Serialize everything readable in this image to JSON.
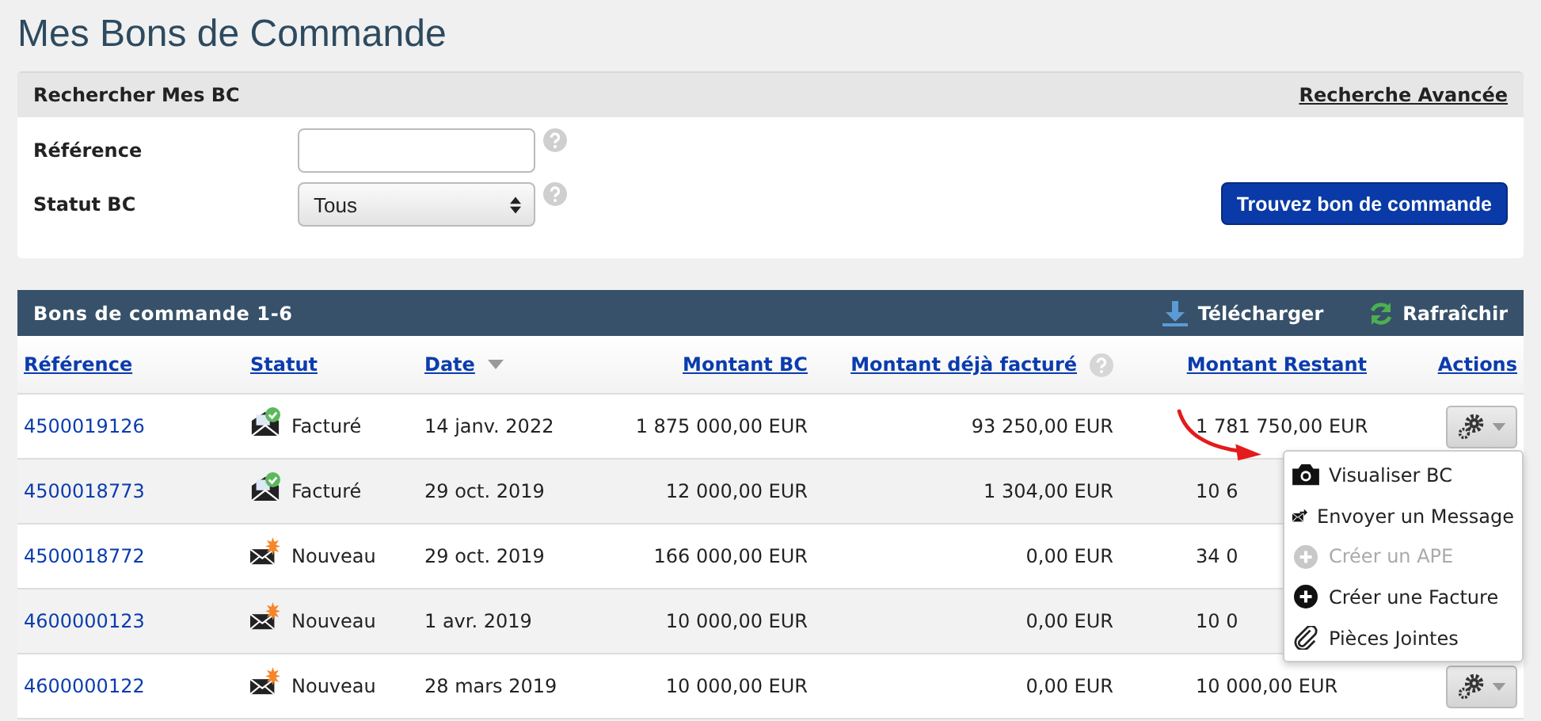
{
  "title": "Mes Bons de Commande",
  "search": {
    "title": "Rechercher Mes BC",
    "advanced_link": "Recherche Avancée",
    "submit": "Trouvez bon de commande",
    "fields": [
      {
        "kind": "text",
        "label": "Référence"
      },
      {
        "kind": "select",
        "label": "Statut BC",
        "value": "Tous"
      }
    ]
  },
  "table": {
    "title": "Bons de commande 1-6",
    "download": "Télécharger",
    "refresh": "Rafraîchir",
    "columns": [
      {
        "label": "Référence",
        "sorted": false,
        "help": false
      },
      {
        "label": "Statut",
        "sorted": false,
        "help": false
      },
      {
        "label": "Date",
        "sorted": true,
        "help": false
      },
      {
        "label": "Montant BC",
        "sorted": false,
        "help": false
      },
      {
        "label": "Montant déjà facturé",
        "sorted": false,
        "help": true
      },
      {
        "label": "Montant Restant",
        "sorted": false,
        "help": false
      },
      {
        "label": "Actions",
        "sorted": false,
        "help": false
      }
    ],
    "rows": [
      {
        "reference": "4500019126",
        "kind": "invoiced",
        "status": "Facturé",
        "date": "14 janv. 2022",
        "amount": "1 875 000,00 EUR",
        "invoiced": "93 250,00 EUR",
        "remaining": "1 781 750,00 EUR",
        "actions_button": true
      },
      {
        "reference": "4500018773",
        "kind": "invoiced",
        "status": "Facturé",
        "date": "29 oct. 2019",
        "amount": "12 000,00 EUR",
        "invoiced": "1 304,00 EUR",
        "remaining": "10 6",
        "actions_button": false
      },
      {
        "reference": "4500018772",
        "kind": "new",
        "status": "Nouveau",
        "date": "29 oct. 2019",
        "amount": "166 000,00 EUR",
        "invoiced": "0,00 EUR",
        "remaining": "34 0",
        "actions_button": false
      },
      {
        "reference": "4600000123",
        "kind": "new",
        "status": "Nouveau",
        "date": "1 avr. 2019",
        "amount": "10 000,00 EUR",
        "invoiced": "0,00 EUR",
        "remaining": "10 0",
        "actions_button": false
      },
      {
        "reference": "4600000122",
        "kind": "new",
        "status": "Nouveau",
        "date": "28 mars 2019",
        "amount": "10 000,00 EUR",
        "invoiced": "0,00 EUR",
        "remaining": "10 000,00 EUR",
        "actions_button": true
      }
    ]
  },
  "menu": {
    "items": [
      {
        "kind": "camera",
        "label": "Visualiser BC",
        "disabled": false
      },
      {
        "kind": "message",
        "label": "Envoyer un Message",
        "disabled": false
      },
      {
        "kind": "plus",
        "label": "Créer un APE",
        "disabled": true
      },
      {
        "kind": "plus",
        "label": "Créer une Facture",
        "disabled": false
      },
      {
        "kind": "clip",
        "label": "Pièces Jointes",
        "disabled": false
      }
    ]
  }
}
